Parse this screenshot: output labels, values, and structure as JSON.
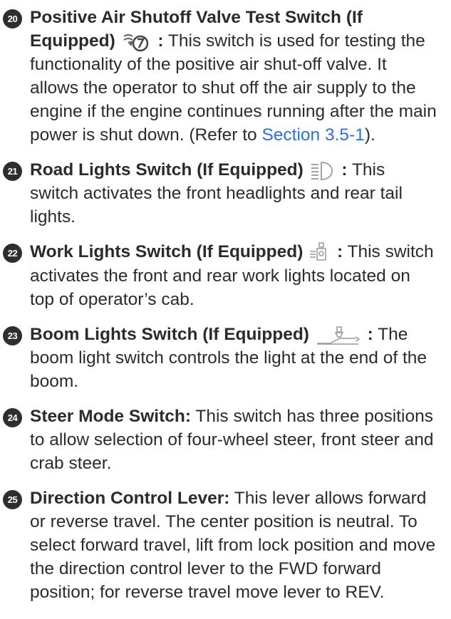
{
  "items": [
    {
      "number": "20",
      "term": "Positive Air Shutoff Valve Test Switch (If Equipped)",
      "icon": "air-shutoff-valve-icon",
      "colon": " :",
      "body_before": " This switch is used for testing the functionality of the positive air shut-off valve. It allows the operator to shut off the air supply to the engine if the engine continues running after the main power is shut down. (Refer to ",
      "link": "Section 3.5-1",
      "body_after": ")."
    },
    {
      "number": "21",
      "term": "Road Lights Switch (If Equipped)",
      "icon": "headlight-icon",
      "colon": " :",
      "body": " This switch activates the front headlights and rear tail lights."
    },
    {
      "number": "22",
      "term": "Work Lights Switch (If Equipped)",
      "icon": "work-light-icon",
      "colon": " :",
      "body": " This switch activates the front and rear work lights located on top of operator’s cab."
    },
    {
      "number": "23",
      "term": "Boom Lights Switch (If Equipped)",
      "icon": "boom-light-icon",
      "colon": " :",
      "body": " The boom light switch controls the light at the end of the boom."
    },
    {
      "number": "24",
      "term": "Steer Mode Switch:",
      "body": " This switch has three positions to allow selection of four-wheel steer, front steer and crab steer."
    },
    {
      "number": "25",
      "term": "Direction Control Lever:",
      "body": " This lever allows forward or reverse travel. The center position is neutral. To select forward travel, lift from lock position and move the direction control lever to the FWD forward position; for reverse travel move lever to REV."
    }
  ],
  "colors": {
    "link": "#2f6fd8",
    "badge": "#2e2e2e",
    "text": "#2b2b2b"
  }
}
